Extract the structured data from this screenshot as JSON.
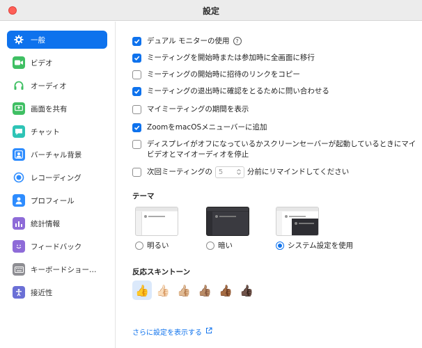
{
  "window": {
    "title": "設定"
  },
  "sidebar": {
    "items": [
      {
        "label": "一般",
        "icon": "gear-icon",
        "color": "#0e72ed",
        "active": true
      },
      {
        "label": "ビデオ",
        "icon": "video-camera-icon",
        "color": "#3fbf63"
      },
      {
        "label": "オーディオ",
        "icon": "headphones-icon",
        "color": "#3fbf63"
      },
      {
        "label": "画面を共有",
        "icon": "share-screen-icon",
        "color": "#3fbf63"
      },
      {
        "label": "チャット",
        "icon": "chat-bubble-icon",
        "color": "#2ec4b6"
      },
      {
        "label": "バーチャル背景",
        "icon": "person-card-icon",
        "color": "#2d8cff"
      },
      {
        "label": "レコーディング",
        "icon": "record-icon",
        "color": "#2d8cff"
      },
      {
        "label": "プロフィール",
        "icon": "profile-icon",
        "color": "#2d8cff"
      },
      {
        "label": "統計情報",
        "icon": "bar-chart-icon",
        "color": "#8e6bd8"
      },
      {
        "label": "フィードバック",
        "icon": "smiley-icon",
        "color": "#8e6bd8"
      },
      {
        "label": "キーボードショートカ…",
        "icon": "keyboard-icon",
        "color": "#8e8e93"
      },
      {
        "label": "接近性",
        "icon": "accessibility-icon",
        "color": "#6b70d6"
      }
    ]
  },
  "general": {
    "options": [
      {
        "label": "デュアル モニターの使用",
        "checked": true,
        "help": "?"
      },
      {
        "label": "ミーティングを開始時または参加時に全画面に移行",
        "checked": true
      },
      {
        "label": "ミーティングの開始時に招待のリンクをコピー",
        "checked": false
      },
      {
        "label": "ミーティングの退出時に確認をとるために問い合わせる",
        "checked": true
      },
      {
        "label": "マイミーティングの期間を表示",
        "checked": false
      },
      {
        "label": "ZoomをmacOSメニューバーに追加",
        "checked": true
      },
      {
        "label": "ディスプレイがオフになっているかスクリーンセーバーが起動しているときにマイビデオとマイオーディオを停止",
        "checked": false
      }
    ],
    "reminder": {
      "before": "次回ミーティングの",
      "value": "5",
      "after": "分前にリマインドしてください",
      "checked": false
    }
  },
  "theme": {
    "heading": "テーマ",
    "options": [
      {
        "label": "明るい",
        "selected": false
      },
      {
        "label": "暗い",
        "selected": false
      },
      {
        "label": "システム設定を使用",
        "selected": true
      }
    ]
  },
  "skin_tone": {
    "heading": "反応スキントーン",
    "tones": [
      "👍",
      "👍🏻",
      "👍🏼",
      "👍🏽",
      "👍🏾",
      "👍🏿"
    ],
    "selected_index": 0
  },
  "footer": {
    "more_settings": "さらに設定を表示する",
    "icon": "external-link-icon"
  },
  "colors": {
    "accent": "#0e72ed",
    "close_button": "#fe5f57"
  }
}
